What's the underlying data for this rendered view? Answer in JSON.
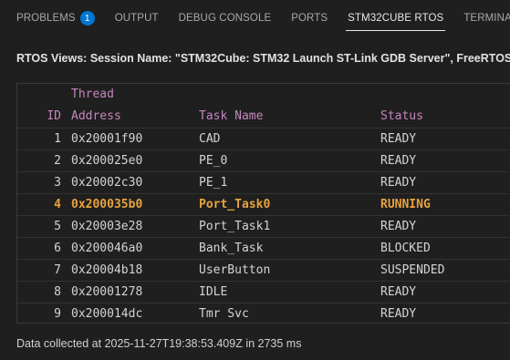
{
  "tabs": [
    {
      "label": "PROBLEMS",
      "badge": "1"
    },
    {
      "label": "OUTPUT"
    },
    {
      "label": "DEBUG CONSOLE"
    },
    {
      "label": "PORTS"
    },
    {
      "label": "STM32CUBE RTOS",
      "active": true
    },
    {
      "label": "TERMINAL"
    }
  ],
  "heading": "RTOS Views: Session Name: \"STM32Cube: STM32 Launch ST-Link GDB Server\", FreeRTOS",
  "table": {
    "header_top": "Thread",
    "headers": {
      "id": "ID",
      "address": "Address",
      "task_name": "Task Name",
      "status": "Status"
    },
    "rows": [
      {
        "id": "1",
        "address": "0x20001f90",
        "task_name": "CAD",
        "status": "READY"
      },
      {
        "id": "2",
        "address": "0x200025e0",
        "task_name": "PE_0",
        "status": "READY"
      },
      {
        "id": "3",
        "address": "0x20002c30",
        "task_name": "PE_1",
        "status": "READY"
      },
      {
        "id": "4",
        "address": "0x200035b0",
        "task_name": "Port_Task0",
        "status": "RUNNING"
      },
      {
        "id": "5",
        "address": "0x20003e28",
        "task_name": "Port_Task1",
        "status": "READY"
      },
      {
        "id": "6",
        "address": "0x200046a0",
        "task_name": "Bank_Task",
        "status": "BLOCKED"
      },
      {
        "id": "7",
        "address": "0x20004b18",
        "task_name": "UserButton",
        "status": "SUSPENDED"
      },
      {
        "id": "8",
        "address": "0x20001278",
        "task_name": "IDLE",
        "status": "READY"
      },
      {
        "id": "9",
        "address": "0x200014dc",
        "task_name": "Tmr Svc",
        "status": "READY"
      }
    ]
  },
  "footer": "Data collected at 2025-11-27T19:38:53.409Z in 2735 ms",
  "colors": {
    "header": "#c586c0",
    "running": "#e8a33d",
    "badge": "#0078d4",
    "background": "#1f1f1f"
  }
}
